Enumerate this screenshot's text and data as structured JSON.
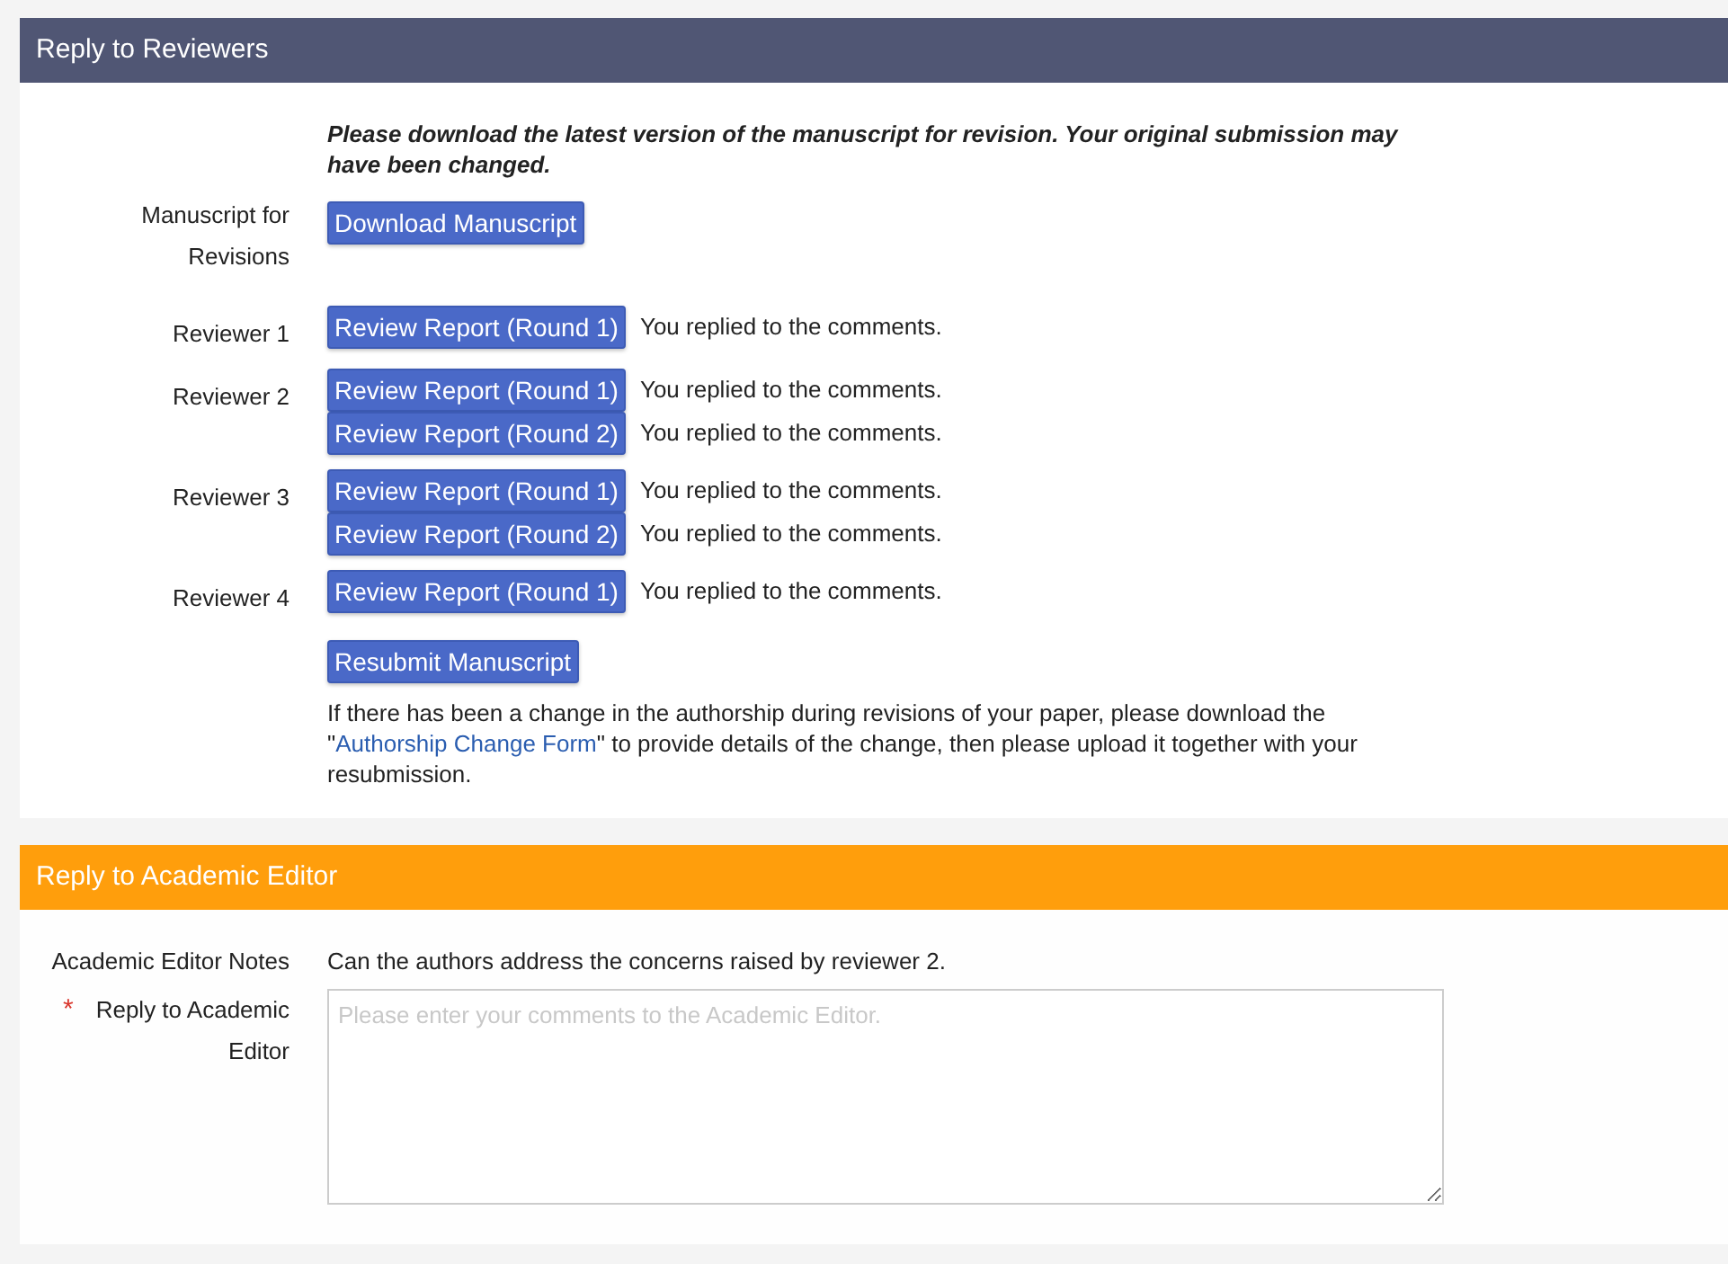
{
  "reviewers_panel": {
    "title": "Reply to Reviewers",
    "notice": "Please download the latest version of the manuscript for revision. Your original submission may have been changed.",
    "manuscript": {
      "label": "Manuscript for Revisions",
      "button": "Download Manuscript"
    },
    "reviewers": [
      {
        "label": "Reviewer 1",
        "reports": [
          {
            "button": "Review Report (Round 1)",
            "status": "You replied to the comments."
          }
        ]
      },
      {
        "label": "Reviewer 2",
        "reports": [
          {
            "button": "Review Report (Round 1)",
            "status": "You replied to the comments."
          },
          {
            "button": "Review Report (Round 2)",
            "status": "You replied to the comments."
          }
        ]
      },
      {
        "label": "Reviewer 3",
        "reports": [
          {
            "button": "Review Report (Round 1)",
            "status": "You replied to the comments."
          },
          {
            "button": "Review Report (Round 2)",
            "status": "You replied to the comments."
          }
        ]
      },
      {
        "label": "Reviewer 4",
        "reports": [
          {
            "button": "Review Report (Round 1)",
            "status": "You replied to the comments."
          }
        ]
      }
    ],
    "resubmit_button": "Resubmit Manuscript",
    "authorship_note": {
      "before": "If there has been a change in the authorship during revisions of your paper, please download the \"",
      "link": "Authorship Change Form",
      "after": "\" to provide details of the change, then please upload it together with your resubmission."
    }
  },
  "editor_panel": {
    "title": "Reply to Academic Editor",
    "notes": {
      "label": "Academic Editor Notes",
      "text": "Can the authors address the concerns raised by reviewer 2."
    },
    "reply": {
      "required_mark": "*",
      "label": "Reply to Academic Editor",
      "placeholder": "Please enter your comments to the Academic Editor."
    }
  }
}
